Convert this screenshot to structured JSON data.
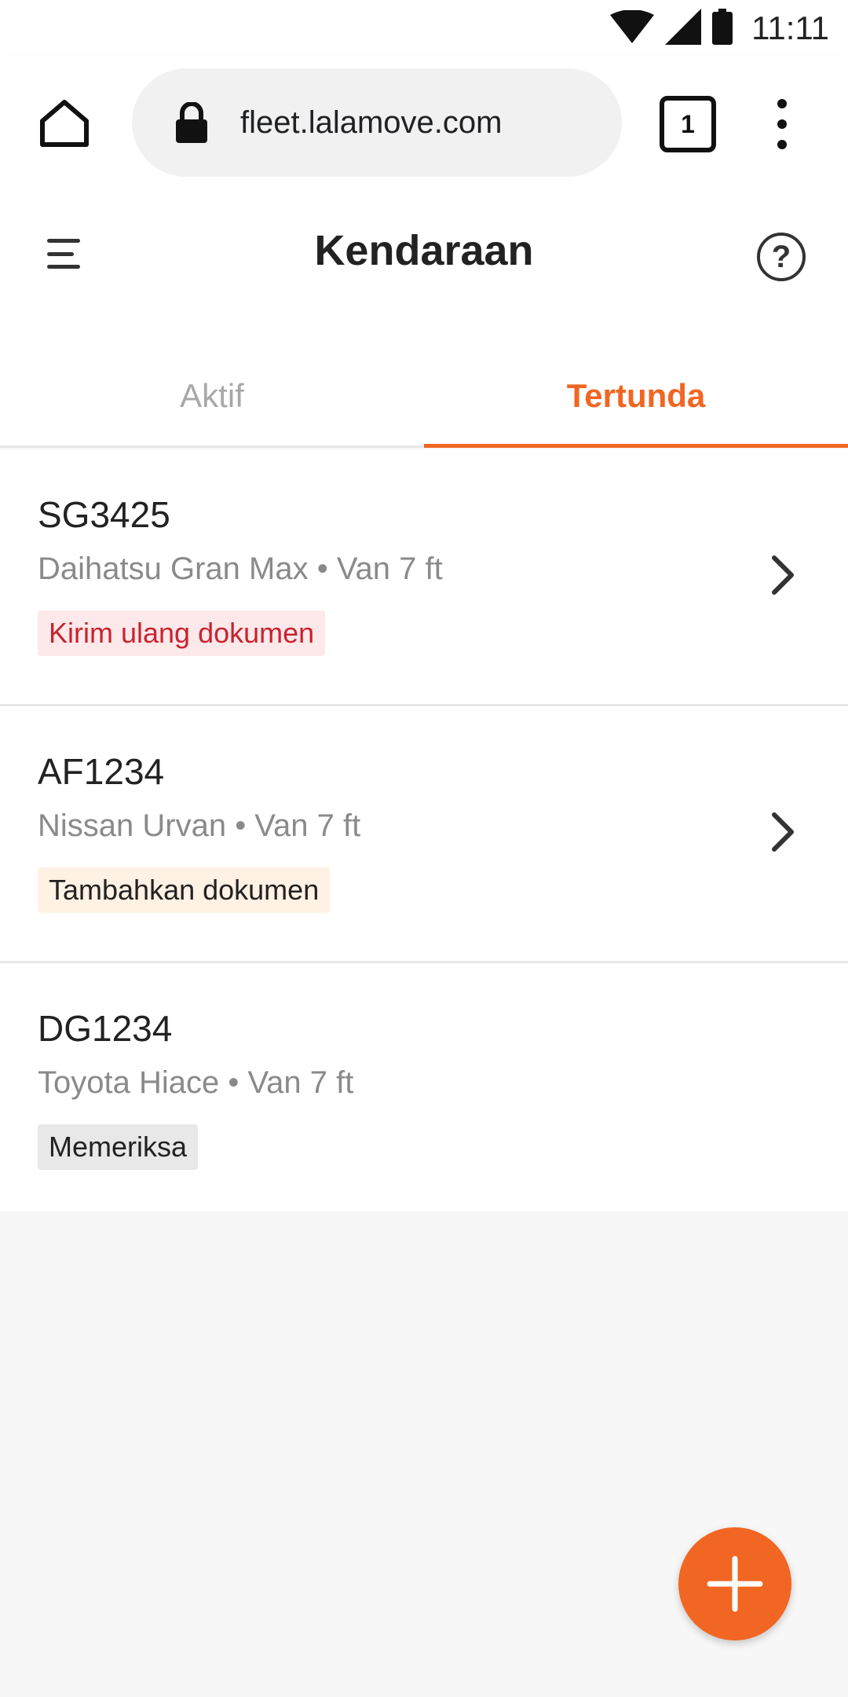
{
  "status_bar": {
    "time": "11:11",
    "icons": [
      "wifi-icon",
      "signal-icon",
      "battery-icon"
    ]
  },
  "browser": {
    "url": "fleet.lalamove.com",
    "tab_count": "1",
    "icons": [
      "home-icon",
      "lock-icon",
      "more-vert-icon"
    ]
  },
  "header": {
    "title": "Kendaraan",
    "help_label": "?"
  },
  "tabs": [
    {
      "label": "Aktif",
      "active": false
    },
    {
      "label": "Tertunda",
      "active": true
    }
  ],
  "vehicles": [
    {
      "plate": "SG3425",
      "desc": "Daihatsu Gran Max • Van 7 ft",
      "status": "Kirim ulang dokumen",
      "status_color": "#c8232f"
    },
    {
      "plate": "AF1234",
      "desc": "Nissan Urvan • Van 7 ft",
      "status": "Tambahkan dokumen",
      "status_color": "#222222"
    },
    {
      "plate": "DG1234",
      "desc": "Toyota Hiace • Van 7 ft",
      "status": "Memeriksa",
      "status_color": "#222222"
    }
  ],
  "colors": {
    "accent": "#f16622",
    "status_red_bg": "#fde8ea",
    "status_orange_bg": "#fff1e3",
    "status_gray_bg": "#e8e8e8"
  },
  "fab": {
    "icon": "plus-icon"
  }
}
